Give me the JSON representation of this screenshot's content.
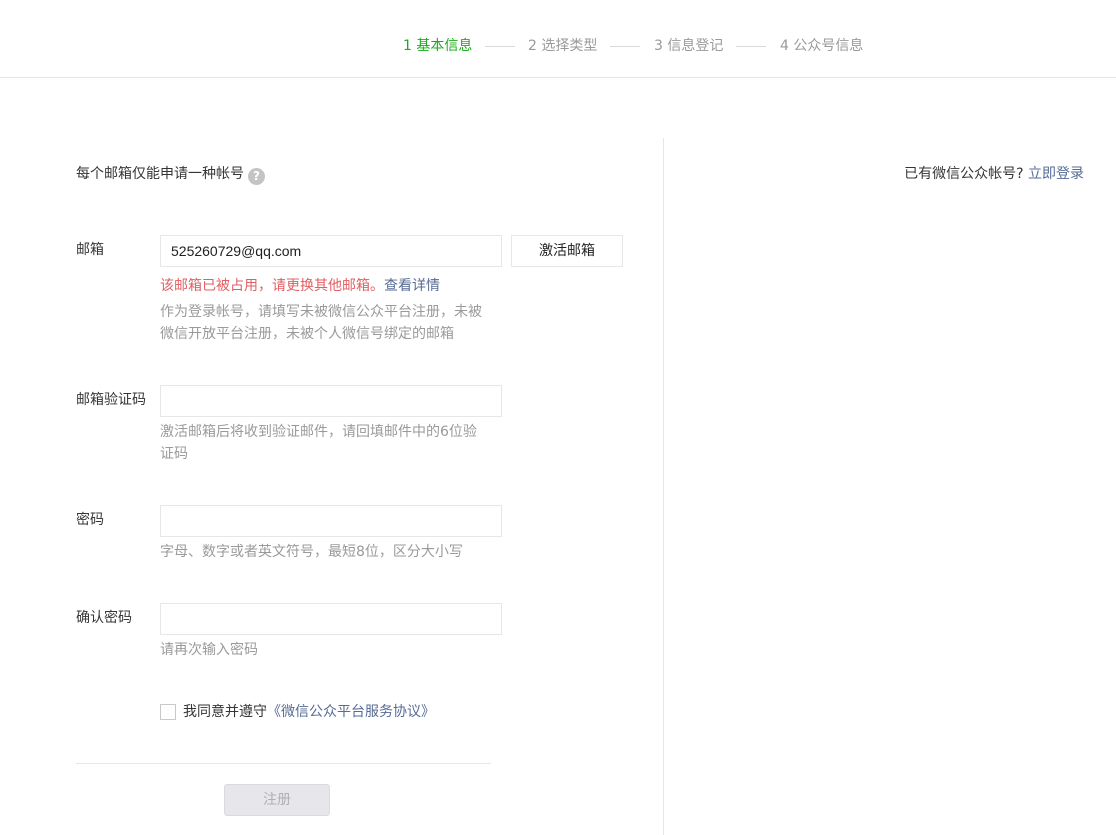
{
  "steps": [
    {
      "label": "1 基本信息",
      "active": true
    },
    {
      "label": "2 选择类型",
      "active": false
    },
    {
      "label": "3 信息登记",
      "active": false
    },
    {
      "label": "4 公众号信息",
      "active": false
    }
  ],
  "colors": {
    "active_step": "#1aad19",
    "link": "#576b95",
    "error": "#e15f63",
    "muted": "#9a9a9a",
    "border": "#e7e7eb"
  },
  "tip": {
    "text": "每个邮箱仅能申请一种帐号",
    "icon": "question-icon",
    "icon_glyph": "?"
  },
  "login_prompt": {
    "text": "已有微信公众帐号?",
    "link": "立即登录"
  },
  "form": {
    "email": {
      "label": "邮箱",
      "value": "525260729@qq.com",
      "activate_button": "激活邮箱",
      "error": "该邮箱已被占用，请更换其他邮箱。",
      "error_link": "查看详情",
      "desc": "作为登录帐号，请填写未被微信公众平台注册，未被微信开放平台注册，未被个人微信号绑定的邮箱"
    },
    "code": {
      "label": "邮箱验证码",
      "value": "",
      "desc": "激活邮箱后将收到验证邮件，请回填邮件中的6位验证码"
    },
    "password": {
      "label": "密码",
      "value": "",
      "desc": "字母、数字或者英文符号，最短8位，区分大小写"
    },
    "confirm": {
      "label": "确认密码",
      "value": "",
      "desc": "请再次输入密码"
    },
    "agree": {
      "checked": false,
      "text": "我同意并遵守",
      "link": "《微信公众平台服务协议》"
    },
    "submit": "注册"
  }
}
